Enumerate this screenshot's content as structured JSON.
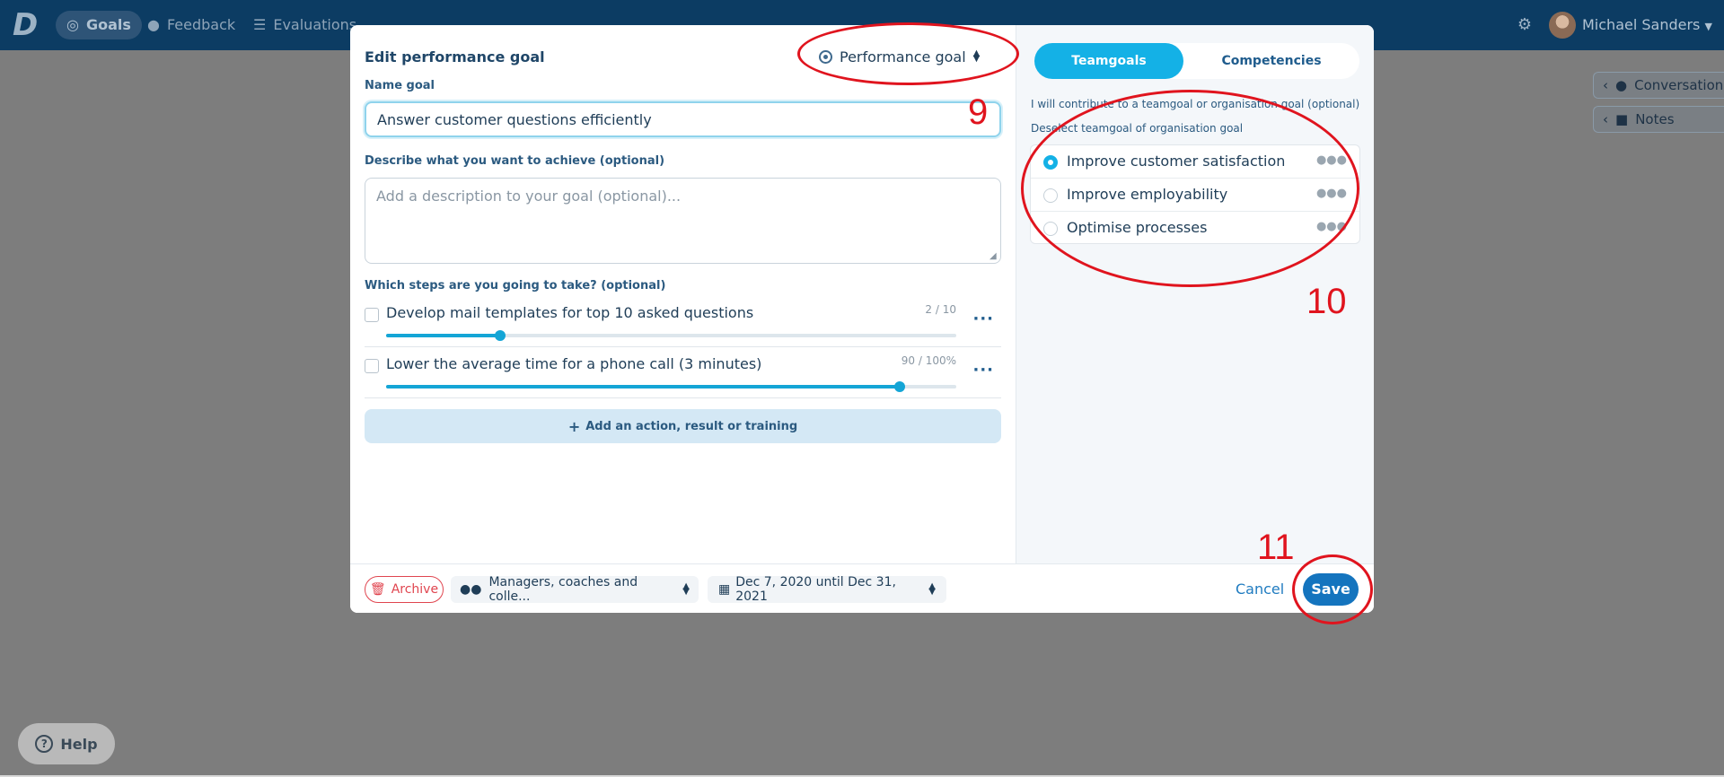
{
  "nav": {
    "logo": "D",
    "items": [
      {
        "label": "Goals",
        "icon": "target-icon",
        "active": true
      },
      {
        "label": "Feedback",
        "icon": "chat-icon",
        "active": false
      },
      {
        "label": "Evaluations",
        "icon": "list-icon",
        "active": false
      }
    ],
    "user_name": "Michael Sanders"
  },
  "side_tabs": {
    "conversation": "Conversation",
    "notes": "Notes"
  },
  "help_label": "Help",
  "modal": {
    "title": "Edit performance goal",
    "type_selected": "Performance goal",
    "name_label": "Name goal",
    "name_value": "Answer customer questions efficiently",
    "description_label": "Describe what you want to achieve (optional)",
    "description_placeholder": "Add a description to your goal (optional)...",
    "steps_label": "Which steps are you going to take? (optional)",
    "steps": [
      {
        "label": "Develop mail templates for top 10 asked questions",
        "count": "2 / 10",
        "progress": 0.2
      },
      {
        "label": "Lower the average time for a phone call (3 minutes)",
        "count": "90 / 100%",
        "progress": 0.9
      }
    ],
    "add_action_label": "Add an action, result or training",
    "tabs": {
      "teamgoals": "Teamgoals",
      "competencies": "Competencies"
    },
    "contribute_text": "I will contribute to a teamgoal or organisation goal (optional)",
    "deselect_text": "Deselect teamgoal of organisation goal",
    "team_goals": [
      {
        "label": "Improve customer satisfaction",
        "selected": true
      },
      {
        "label": "Improve employability",
        "selected": false
      },
      {
        "label": "Optimise processes",
        "selected": false
      }
    ],
    "footer": {
      "archive_label": "Archive",
      "share_label": "Managers, coaches and colle...",
      "date_label": "Dec 7, 2020 until Dec 31, 2021",
      "cancel_label": "Cancel",
      "save_label": "Save"
    }
  },
  "annotations": [
    "9",
    "10",
    "11"
  ],
  "colors": {
    "accent": "#14b1e6",
    "primary": "#1474be",
    "danger": "#e0454f",
    "annotation": "#e0141e",
    "nav_bg": "#0c3c63"
  }
}
